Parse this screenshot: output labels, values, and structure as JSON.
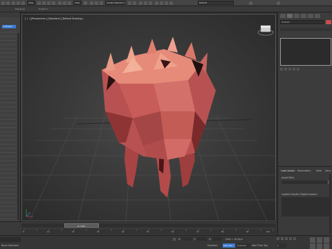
{
  "app": {
    "toolbar": {
      "selection_filter": "Create Selection Set",
      "view_dropdown": "View",
      "workspace_label": "Workspaces:",
      "workspace_value": "Default"
    },
    "ribbon": {
      "tab1": "Modeling",
      "tab2": "Freeform",
      "tab3": "Selection",
      "tab4": "Object Paint",
      "tab5": "Populate"
    },
    "viewport": {
      "label": "[ + ] [Perspective ] [Standard ] [Default Shading ]"
    },
    "command_panel": {
      "object_name": "Tooth01",
      "color_hex": "#c64f4f",
      "load_assets_title": "Load Assets",
      "tab_parameters": "Parameters",
      "tab_shell": "Shell",
      "tab_misc": "Sens",
      "asset_path_label": "Asset Path:",
      "loaded_assets_label": "Loaded Houdini Digital Assets:"
    },
    "timeline": {
      "frame_counter": "0 / 100",
      "ticks": [
        "0",
        "5",
        "10",
        "15",
        "20",
        "25",
        "30",
        "35",
        "40",
        "45",
        "50",
        "55",
        "60",
        "65",
        "70",
        "75",
        "80",
        "85",
        "90",
        "95",
        "100"
      ]
    },
    "status": {
      "selection_text": "None Selected",
      "x_label": "X:",
      "x_value": "",
      "y_label": "Y:",
      "y_value": "",
      "z_label": "Z:",
      "z_value": "",
      "grid_text": "Grid = 10.0cm",
      "auto_key": "Auto Key",
      "selected": "Selected",
      "set_key": "Set Key",
      "key_filters": "Key Filters...",
      "enabled": "Enabled:",
      "add_time_tag": "Add Time Tag",
      "frame_value": "0"
    },
    "colors": {
      "tooth_base": "#b25353",
      "tooth_light": "#e08a7a",
      "tooth_dark": "#5a1e1e",
      "accent": "#3b7bd1"
    }
  }
}
